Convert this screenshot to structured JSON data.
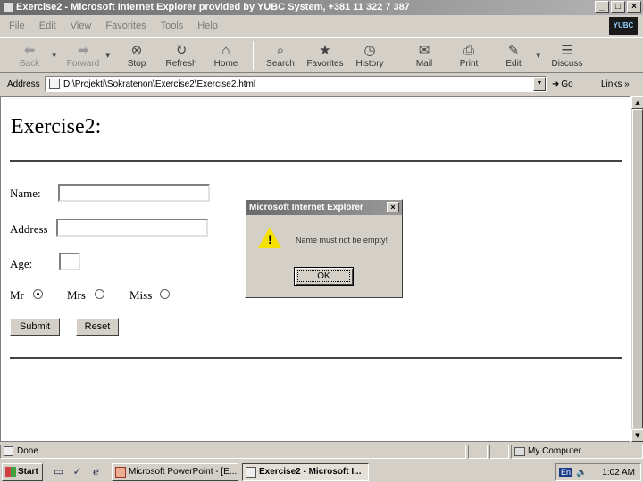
{
  "window": {
    "title": "Exercise2 - Microsoft Internet Explorer provided by YUBC System, +381 11 322 7 387",
    "min": "_",
    "max": "□",
    "close": "×"
  },
  "menu": {
    "items": [
      "File",
      "Edit",
      "View",
      "Favorites",
      "Tools",
      "Help"
    ],
    "logo": "YUBC"
  },
  "toolbar": {
    "back": "Back",
    "forward": "Forward",
    "stop": "Stop",
    "refresh": "Refresh",
    "home": "Home",
    "search": "Search",
    "favorites": "Favorites",
    "history": "History",
    "mail": "Mail",
    "print": "Print",
    "edit": "Edit",
    "discuss": "Discuss"
  },
  "address": {
    "label": "Address",
    "value": "D:\\Projekti\\Sokratenon\\Exercise2\\Exercise2.html",
    "go": "Go",
    "links": "Links"
  },
  "page": {
    "title": "Exercise2:",
    "name_label": "Name:",
    "address_label": "Address",
    "age_label": "Age:",
    "mr_label": "Mr",
    "mrs_label": "Mrs",
    "miss_label": "Miss",
    "submit": "Submit",
    "reset": "Reset"
  },
  "dialog": {
    "title": "Microsoft Internet Explorer",
    "message": "Name must not be empty!",
    "ok": "OK"
  },
  "status": {
    "text": "Done",
    "zone": "My Computer"
  },
  "taskbar": {
    "start": "Start",
    "task1": "Microsoft PowerPoint - [E...",
    "task2": "Exercise2 - Microsoft I...",
    "lang": "En",
    "clock": "1:02 AM"
  }
}
